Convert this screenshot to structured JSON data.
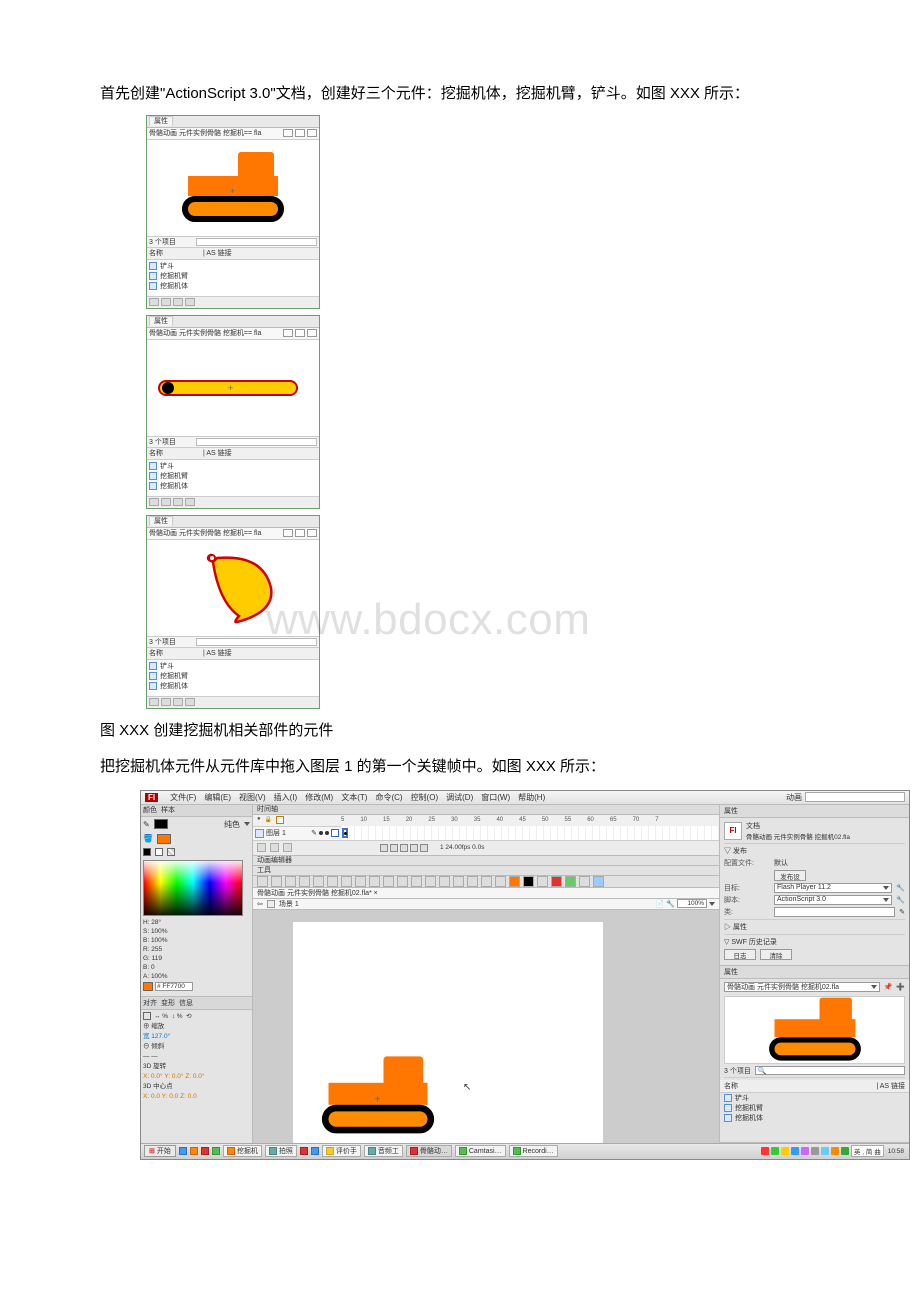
{
  "text": {
    "intro": "首先创建\"ActionScript 3.0\"文档，创建好三个元件：挖掘机体，挖掘机臂，铲斗。如图 XXX 所示：",
    "caption1": "图 XXX 创建挖掘机相关部件的元件",
    "caption2": "把挖掘机体元件从元件库中拖入图层 1 的第一个关键帧中。如图 XXX 所示："
  },
  "watermark": "www.bdocx.com",
  "library": {
    "tab": "属性",
    "filename": "骨骼动画 元件实例骨骼 挖掘机== fla",
    "items_count": "3 个项目",
    "col_name": "名称",
    "col_link": "| AS 链接",
    "items": [
      "铲斗",
      "挖掘机臂",
      "挖掘机体"
    ]
  },
  "flash": {
    "menu": [
      "文件(F)",
      "编辑(E)",
      "视图(V)",
      "插入(I)",
      "修改(M)",
      "文本(T)",
      "命令(C)",
      "控制(O)",
      "调试(D)",
      "窗口(W)",
      "帮助(H)"
    ],
    "logo": "Fl",
    "search_label": "动画",
    "left_tabs": [
      "颜色",
      "样本"
    ],
    "fill_label": "纯色",
    "hsb": [
      "H: 28°",
      "S: 100%",
      "B: 100%"
    ],
    "rgb": [
      "R: 255",
      "G: 119",
      "B: 0",
      "A: 100%"
    ],
    "hex": "# FF7700",
    "transform_tabs": [
      "对齐",
      "变形",
      "信息"
    ],
    "transform_lines": [
      "⊕ 缩放",
      "宽 127.0°",
      "⊖ 倾斜",
      "— —",
      "3D 旋转",
      "X: 0.0°    Y: 0.0°    Z: 0.0°",
      "3D 中心点",
      "X: 0.0    Y: 0.0    Z: 0.0"
    ],
    "timeline_tab": "时间轴",
    "layer1": "图层 1",
    "ruler": [
      "5",
      "10",
      "15",
      "20",
      "25",
      "30",
      "35",
      "40",
      "45",
      "50",
      "55",
      "60",
      "65",
      "70",
      "7"
    ],
    "tl_status": "1    24.00fps   0.0s",
    "anim_label": "动画编辑器",
    "tools_label": "工具",
    "doc_tab": "骨骼动画 元件实例骨骼 挖掘机02.fla* ×",
    "scene": "场景 1",
    "zoom": "100%",
    "status_left": "场景",
    "properties": {
      "tab": "属性",
      "doc_label": "文档",
      "doc_name": "骨骼动画 元件实例骨骼 挖掘机02.fla",
      "publish_section": "发布",
      "profile_label": "配置文件:",
      "profile_value": "默认",
      "publish_settings": "发布设置…",
      "target_label": "目标:",
      "target_value": "Flash Player 11.2",
      "script_label": "脚本:",
      "script_value": "ActionScript 3.0",
      "class_label": "类:",
      "props_section": "属性",
      "swf_history": "SWF 历史记录",
      "log_btn": "日志",
      "clear_btn": "清除"
    },
    "r_library": {
      "tab": "属性",
      "filename": "骨骼动画 元件实例骨骼 挖掘机02.fla",
      "items_count": "3 个项目",
      "col_name": "名称",
      "col_link": "| AS 链接",
      "items": [
        "铲斗",
        "挖掘机臂",
        "挖掘机体"
      ]
    },
    "taskbar": {
      "start": "开始",
      "items": [
        "挖掘机",
        "拍照",
        "评价手",
        "音频工",
        "骨骼动…",
        "Camtasi…",
        "Recordi…"
      ],
      "lang": "英 , 简 曲",
      "clock": "10:58"
    }
  }
}
